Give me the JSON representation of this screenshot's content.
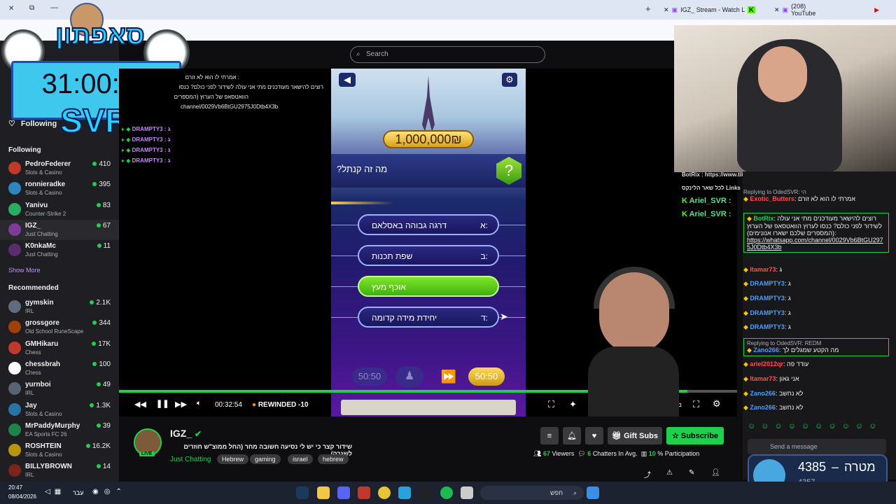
{
  "browser": {
    "tabs": [
      {
        "label": "IGZ_ Stream - Watch Live o"
      },
      {
        "label": "(208) YouTube"
      }
    ]
  },
  "overlay": {
    "logo_text": "סאפתון",
    "timer": "31:00:24",
    "svr": "SVR"
  },
  "sidebar": {
    "following_btn": "Following",
    "following_header": "Following",
    "followed": [
      {
        "name": "PedroFederer",
        "category": "Slots & Casino",
        "viewers": "410",
        "color": "#c0392b"
      },
      {
        "name": "ronnieradke",
        "category": "Slots & Casino",
        "viewers": "395",
        "color": "#2e86c1"
      },
      {
        "name": "Yanivu",
        "category": "Counter-Strike 2",
        "viewers": "83",
        "color": "#27ae60"
      },
      {
        "name": "IGZ_",
        "category": "Just Chatting",
        "viewers": "67",
        "color": "#7d3c98"
      },
      {
        "name": "K0nkaMc",
        "category": "Just Chatting",
        "viewers": "11",
        "color": "#5b2c6f"
      }
    ],
    "show_more": "Show More",
    "recommended_header": "Recommended",
    "recommended": [
      {
        "name": "gymskin",
        "category": "IRL",
        "viewers": "2.1K",
        "color": "#5d6d7e"
      },
      {
        "name": "grossgore",
        "category": "Old School RuneScape",
        "viewers": "344",
        "color": "#a04000"
      },
      {
        "name": "GMHikaru",
        "category": "Chess",
        "viewers": "17K",
        "color": "#c0392b"
      },
      {
        "name": "chessbrah",
        "category": "Chess",
        "viewers": "100",
        "color": "#ffffff"
      },
      {
        "name": "yurnboi",
        "category": "IRL",
        "viewers": "49",
        "color": "#566573"
      },
      {
        "name": "Jay",
        "category": "Slots & Casino",
        "viewers": "1.3K",
        "color": "#2874a6"
      },
      {
        "name": "MrPaddyMurphy",
        "category": "EA Sports FC 26",
        "viewers": "39",
        "color": "#1e8449"
      },
      {
        "name": "ROSHTEIN",
        "category": "Slots & Casino",
        "viewers": "16.2K",
        "color": "#b7950b"
      },
      {
        "name": "BILLYBROWN",
        "category": "IRL",
        "viewers": "14",
        "color": "#7b241c"
      }
    ]
  },
  "search": {
    "placeholder": "Search"
  },
  "left_chat": {
    "lines": [
      "אמרתי לו הוא לא זורם :",
      "רוצים להישאר מעודכנים מתי אני עולה לשידור לפני כולם? כנסו",
      "הוואטסאפ של הערוץ (המספרים",
      "channel/0029Vb6BtGU2975J0Dtb4X3b"
    ],
    "drampty": [
      "DRAMPTY3 : ג",
      "DRAMPTY3 : ג",
      "DRAMPTY3 : ג",
      "DRAMPTY3 : ג"
    ]
  },
  "game": {
    "prize": "1,000,000₪",
    "question": "מה זה קנתל?",
    "answers": [
      {
        "letter": "א:",
        "text": "דרגה גבוהה באסלאם",
        "correct": false
      },
      {
        "letter": "ב:",
        "text": "שפת תכנות",
        "correct": false
      },
      {
        "letter": "",
        "text": "אוכף מעץ",
        "correct": true
      },
      {
        "letter": "ד:",
        "text": "יחידת מידה קדומה",
        "correct": false
      }
    ],
    "lifeline_5050_a": "50:50",
    "lifeline_5050_b": "50:50"
  },
  "player": {
    "time": "00:32:54",
    "rewind": "REWINDED -10",
    "progress": 0.92
  },
  "channel": {
    "name": "IGZ_",
    "live": "LIVE",
    "title": "שידור קצר כי יש לי נסיעה חשובה מחר (החל ממוצ\"ש חוזרים לשגרה)",
    "category": "Just Chatting",
    "tags": [
      "Hebrew",
      "gaming",
      "israel",
      "hebrew"
    ],
    "gift_subs": "Gift Subs",
    "subscribe": "Subscribe",
    "viewers_count": "67",
    "viewers_label": "Viewers",
    "chatters_count": "6",
    "chatters_label": "Chatters In Avg.",
    "participation_count": "10",
    "participation_label": "% Participation"
  },
  "overlay_chat": {
    "botrix_line": "BotRix : https://www.tiktok.com",
    "links_line": "לכל שאר הלינקס Links",
    "ariel1": "Ariel_SVR :",
    "ariel2": "Ariel_SVR :"
  },
  "chat": {
    "messages": [
      {
        "reply": "Replying to OdedSVR: הי",
        "user": "Exotic_Butters",
        "text": "אמרתי לו הוא לא זורם",
        "color": "#ff4f4f"
      },
      {
        "user": "BotRix",
        "text": "רוצים להישאר מעודכנים מתי אני עולה לשידור לפני כולם? כנסו לערוץ הוואטסאפ של הערוץ (המספרים שלכם ישארו אנונימים):",
        "link": "https://whatsapp.com/channel/0029Vb6BtGU2975J0Dtb4X3b",
        "color": "#1fd14a"
      },
      {
        "user": "Itamar73",
        "text": "ג",
        "color": "#ff4f4f"
      },
      {
        "user": "DRAMPTY3",
        "text": "ג",
        "color": "#4f9dff"
      },
      {
        "user": "DRAMPTY3",
        "text": "ג",
        "color": "#4f9dff"
      },
      {
        "user": "DRAMPTY3",
        "text": "ג",
        "color": "#4f9dff"
      },
      {
        "user": "DRAMPTY3",
        "text": "ג",
        "color": "#4f9dff"
      },
      {
        "reply": "Replying to OdedSVR: REDM",
        "user": "Zano266",
        "text": "מה הקטע שמגלים לך",
        "color": "#4f9dff"
      },
      {
        "user": "ariel2012qr",
        "text": "עודד פה",
        "color": "#ff4f4f"
      },
      {
        "user": "Itamar73",
        "text": "אני גאון",
        "color": "#ff4f4f"
      },
      {
        "user": "Zano266",
        "text": "לא נחשב",
        "color": "#4f9dff"
      },
      {
        "user": "Zano266",
        "text": "לא נחשב",
        "color": "#4f9dff"
      }
    ],
    "input_placeholder": "Send a message"
  },
  "goal_widget": {
    "current": "4385",
    "label": "מטרה",
    "dash": "–",
    "target": "4357"
  },
  "taskbar": {
    "time": "20:47",
    "date": "08/04/2026",
    "lang": "עבר",
    "search": "חפש"
  }
}
